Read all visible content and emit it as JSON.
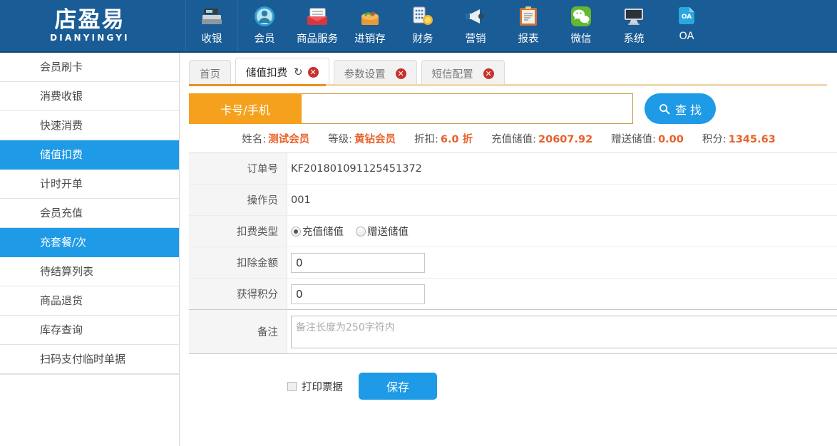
{
  "brand": {
    "logo_cn": "店盈易",
    "logo_en": "DIANYINGYI",
    "primary_blue": "#1a5c96",
    "accent_blue": "#1e9ae6",
    "accent_orange": "#f5a11d",
    "value_orange": "#e8622a"
  },
  "topnav": {
    "items": [
      {
        "label": "收银",
        "icon": "cash-register-icon"
      },
      {
        "label": "会员",
        "icon": "member-avatar-icon"
      },
      {
        "label": "商品服务",
        "icon": "goods-box-icon"
      },
      {
        "label": "进销存",
        "icon": "inventory-icon"
      },
      {
        "label": "财务",
        "icon": "finance-coins-icon"
      },
      {
        "label": "营销",
        "icon": "megaphone-icon"
      },
      {
        "label": "报表",
        "icon": "clipboard-report-icon"
      },
      {
        "label": "微信",
        "icon": "wechat-icon"
      },
      {
        "label": "系统",
        "icon": "monitor-icon"
      },
      {
        "label": "OA",
        "icon": "oa-icon"
      }
    ]
  },
  "sidebar": {
    "items": [
      {
        "label": "会员刷卡",
        "active": false
      },
      {
        "label": "消费收银",
        "active": false
      },
      {
        "label": "快速消费",
        "active": false
      },
      {
        "label": "储值扣费",
        "active": true
      },
      {
        "label": "计时开单",
        "active": false
      },
      {
        "label": "会员充值",
        "active": false
      },
      {
        "label": "充套餐/次",
        "active": true
      },
      {
        "label": "待结算列表",
        "active": false
      },
      {
        "label": "商品退货",
        "active": false
      },
      {
        "label": "库存查询",
        "active": false
      },
      {
        "label": "扫码支付临时单据",
        "active": false
      }
    ]
  },
  "tabs": [
    {
      "label": "首页",
      "active": false,
      "closable": false,
      "refresh": false
    },
    {
      "label": "储值扣费",
      "active": true,
      "closable": true,
      "refresh": true
    },
    {
      "label": "参数设置",
      "active": false,
      "closable": true,
      "refresh": false
    },
    {
      "label": "短信配置",
      "active": false,
      "closable": true,
      "refresh": false
    }
  ],
  "tab_icons": {
    "refresh": "↻",
    "close": "✖"
  },
  "search": {
    "label": "卡号/手机",
    "value": "",
    "placeholder": "",
    "button_label": "查 找",
    "button_icon": "search-icon"
  },
  "member": [
    {
      "label": "姓名:",
      "value": "测试会员"
    },
    {
      "label": "等级:",
      "value": "黄钻会员"
    },
    {
      "label": "折扣:",
      "value": "6.0 折"
    },
    {
      "label": "充值储值:",
      "value": "20607.92"
    },
    {
      "label": "赠送储值:",
      "value": "0.00"
    },
    {
      "label": "积分:",
      "value": "1345.63"
    }
  ],
  "form": {
    "order_no": {
      "label": "订单号",
      "value": "KF201801091125451372"
    },
    "operator": {
      "label": "操作员",
      "value": "001"
    },
    "fee_type": {
      "label": "扣费类型",
      "options": [
        {
          "label": "充值储值",
          "checked": true
        },
        {
          "label": "赠送储值",
          "checked": false
        }
      ]
    },
    "deduct_amount": {
      "label": "扣除金额",
      "value": "0"
    },
    "earn_points": {
      "label": "获得积分",
      "value": "0"
    },
    "remark": {
      "label": "备注",
      "value": "",
      "placeholder": "备注长度为250字符内"
    }
  },
  "actions": {
    "print_receipt_label": "打印票据",
    "print_receipt_checked": false,
    "save_label": "保存"
  }
}
